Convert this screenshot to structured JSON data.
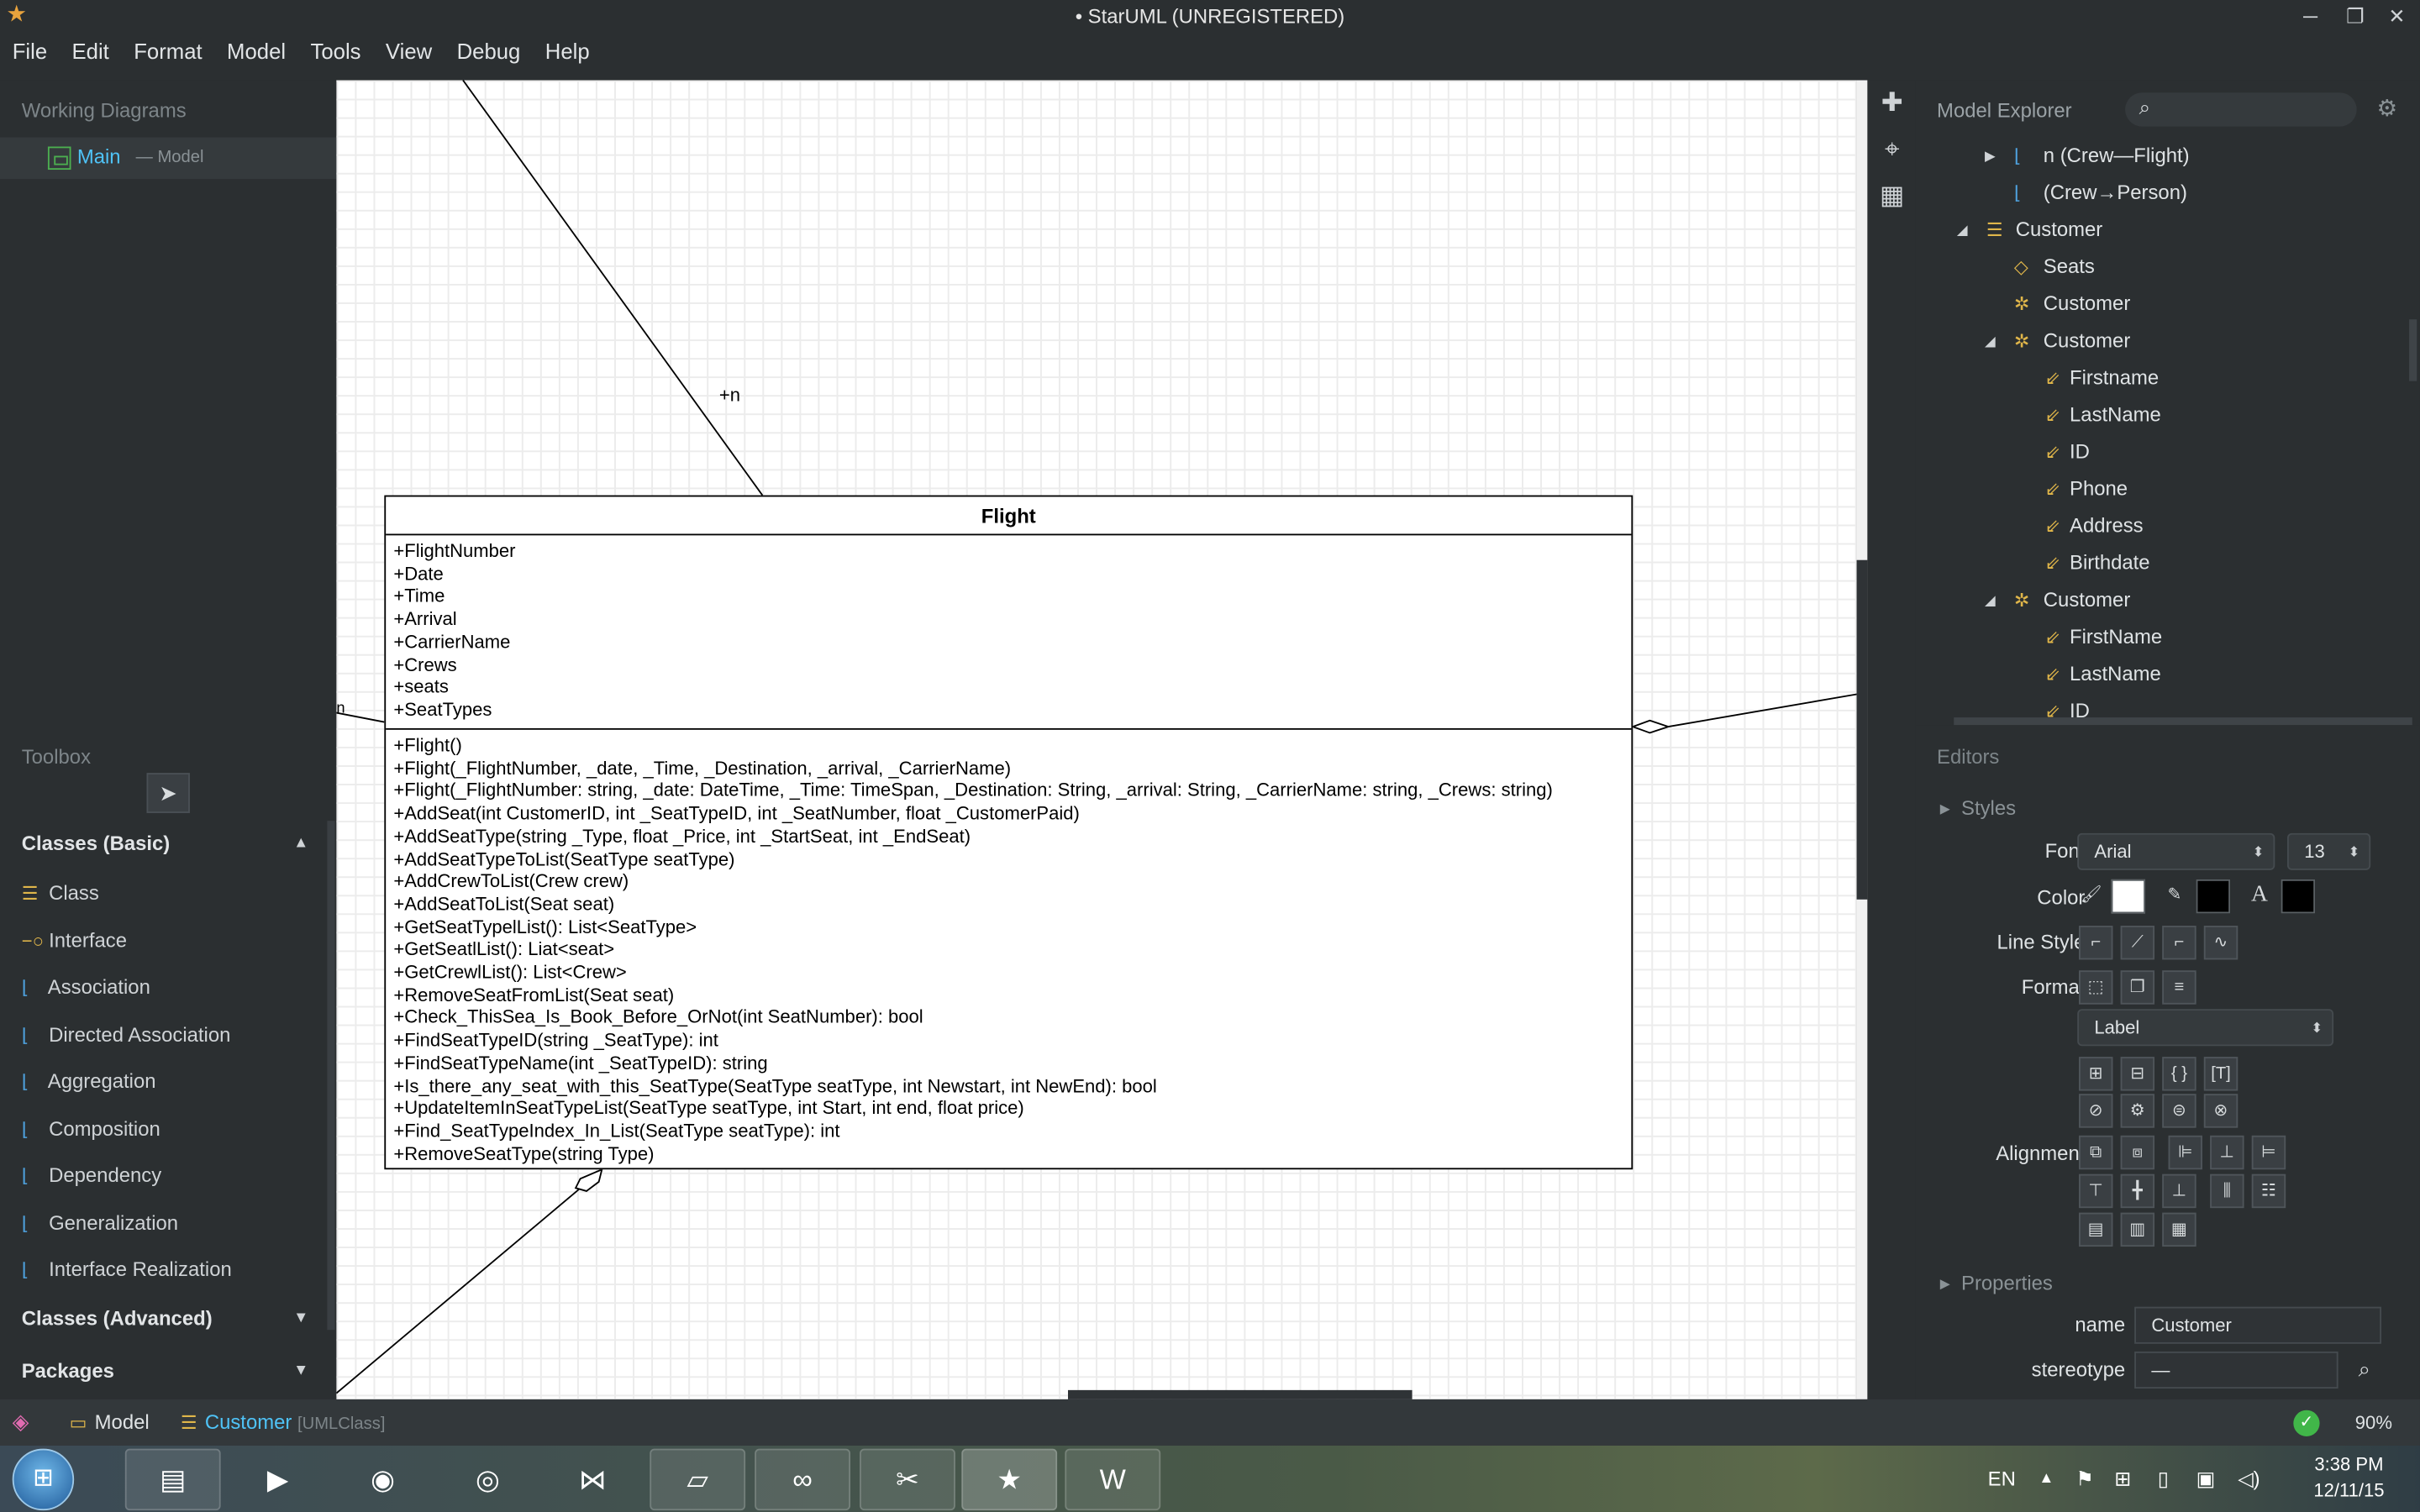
{
  "window": {
    "title": "• StarUML (UNREGISTERED)",
    "controls": [
      "─",
      "❐",
      "✕"
    ]
  },
  "menu": [
    "File",
    "Edit",
    "Format",
    "Model",
    "Tools",
    "View",
    "Debug",
    "Help"
  ],
  "working_diagrams": {
    "title": "Working Diagrams",
    "item_name": "Main",
    "item_sub": "— Model"
  },
  "toolbox": {
    "title": "Toolbox",
    "section_basic": "Classes (Basic)",
    "items": [
      {
        "label": "Class",
        "icon": "class-icon"
      },
      {
        "label": "Interface",
        "icon": "interface-icon"
      },
      {
        "label": "Association",
        "icon": "association-icon"
      },
      {
        "label": "Directed Association",
        "icon": "directed-association-icon"
      },
      {
        "label": "Aggregation",
        "icon": "aggregation-icon"
      },
      {
        "label": "Composition",
        "icon": "composition-icon"
      },
      {
        "label": "Dependency",
        "icon": "dependency-icon"
      },
      {
        "label": "Generalization",
        "icon": "generalization-icon"
      },
      {
        "label": "Interface Realization",
        "icon": "interface-realization-icon"
      }
    ],
    "section_advanced": "Classes (Advanced)",
    "section_packages": "Packages"
  },
  "diagram": {
    "assoc_label_n_top": "+n",
    "assoc_label_n_left": "n",
    "class": {
      "name": "Flight",
      "attributes": [
        "+FlightNumber",
        "+Date",
        "+Time",
        "+Arrival",
        "+CarrierName",
        "+Crews",
        "+seats",
        "+SeatTypes"
      ],
      "operations": [
        "+Flight()",
        "+Flight(_FlightNumber, _date, _Time, _Destination, _arrival, _CarrierName)",
        "+Flight(_FlightNumber: string, _date: DateTime, _Time: TimeSpan, _Destination: String, _arrival: String, _CarrierName: string, _Crews: string)",
        "+AddSeat(int CustomerID, int _SeatTypeID, int _SeatNumber, float _CustomerPaid)",
        "+AddSeatType(string _Type, float _Price, int _StartSeat, int _EndSeat)",
        "+AddSeatTypeToList(SeatType seatType)",
        "+AddCrewToList(Crew crew)",
        "+AddSeatToList(Seat seat)",
        "+GetSeatTypelList(): List<SeatType>",
        "+GetSeatlList(): Liat<seat>",
        "+GetCrewlList(): List<Crew>",
        "+RemoveSeatFromList(Seat  seat)",
        "+Check_ThisSea_Is_Book_Before_OrNot(int SeatNumber): bool",
        "+FindSeatTypeID(string _SeatType): int",
        "+FindSeatTypeName(int _SeatTypeID): string",
        "+Is_there_any_seat_with_this_SeatType(SeatType seatType, int Newstart, int NewEnd): bool",
        "+UpdateItemInSeatTypeList(SeatType seatType, int Start, int end, float price)",
        "+Find_SeatTypeIndex_In_List(SeatType seatType): int",
        "+RemoveSeatType(string Type)"
      ]
    }
  },
  "explorer": {
    "title": "Model Explorer",
    "search_placeholder": "",
    "rows": [
      {
        "label": "n (Crew—Flight)",
        "icon": "association-icon",
        "indent": 2,
        "toggle": "▶"
      },
      {
        "label": "(Crew→Person)",
        "icon": "directed-association-icon",
        "indent": 2,
        "toggle": ""
      },
      {
        "label": "Customer",
        "icon": "class-icon",
        "indent": 1,
        "toggle": "◢"
      },
      {
        "label": "Seats",
        "icon": "attribute-icon",
        "indent": 2,
        "toggle": ""
      },
      {
        "label": "Customer",
        "icon": "operation-icon",
        "indent": 2,
        "toggle": ""
      },
      {
        "label": "Customer",
        "icon": "operation-icon",
        "indent": 2,
        "toggle": "◢"
      },
      {
        "label": "Firstname",
        "icon": "parameter-icon",
        "indent": 3,
        "toggle": ""
      },
      {
        "label": "LastName",
        "icon": "parameter-icon",
        "indent": 3,
        "toggle": ""
      },
      {
        "label": "ID",
        "icon": "parameter-icon",
        "indent": 3,
        "toggle": ""
      },
      {
        "label": "Phone",
        "icon": "parameter-icon",
        "indent": 3,
        "toggle": ""
      },
      {
        "label": "Address",
        "icon": "parameter-icon",
        "indent": 3,
        "toggle": ""
      },
      {
        "label": "Birthdate",
        "icon": "parameter-icon",
        "indent": 3,
        "toggle": ""
      },
      {
        "label": "Customer",
        "icon": "operation-icon",
        "indent": 2,
        "toggle": "◢"
      },
      {
        "label": "FirstName",
        "icon": "parameter-icon",
        "indent": 3,
        "toggle": ""
      },
      {
        "label": "LastName",
        "icon": "parameter-icon",
        "indent": 3,
        "toggle": ""
      },
      {
        "label": "ID",
        "icon": "parameter-icon",
        "indent": 3,
        "toggle": ""
      }
    ]
  },
  "editors": {
    "title": "Editors",
    "styles_label": "Styles",
    "font_label": "Font",
    "font_name": "Arial",
    "font_size": "13",
    "color_label": "Color",
    "fill_color": "#ffffff",
    "line_color": "#000000",
    "font_color": "#000000",
    "line_style_label": "Line Style",
    "format_label": "Format",
    "format_value": "Label",
    "alignment_label": "Alignment",
    "properties_label": "Properties",
    "name_label": "name",
    "name_value": "Customer",
    "stereotype_label": "stereotype",
    "stereotype_value": "—"
  },
  "statusbar": {
    "crumb_model": "Model",
    "crumb_selected": "Customer",
    "crumb_type": "[UMLClass]",
    "zoom": "90%"
  },
  "taskbar": {
    "lang": "EN",
    "time": "3:38 PM",
    "date": "12/11/15"
  }
}
